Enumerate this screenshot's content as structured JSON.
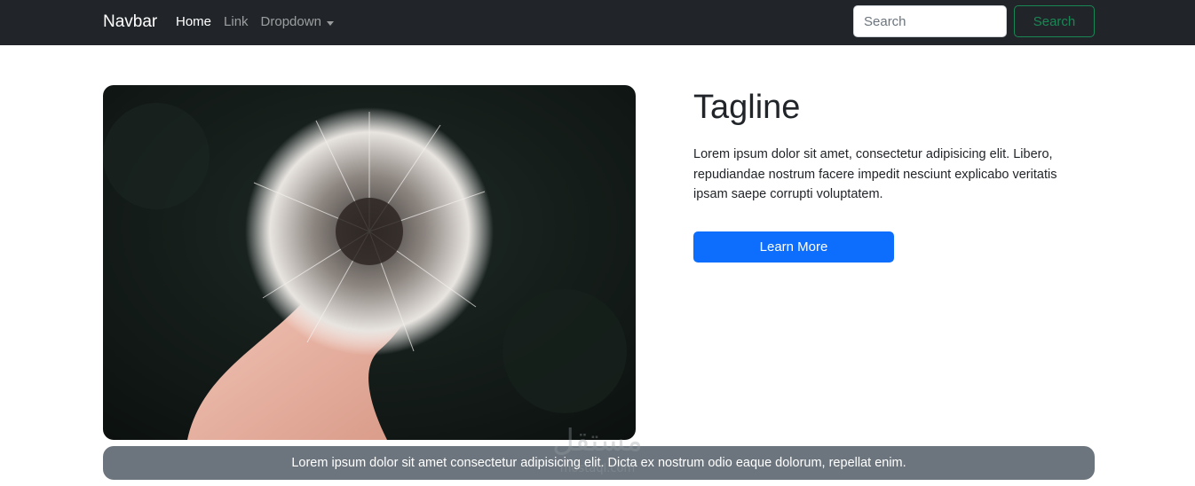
{
  "navbar": {
    "brand": "Navbar",
    "links": [
      {
        "label": "Home",
        "active": true
      },
      {
        "label": "Link",
        "active": false
      },
      {
        "label": "Dropdown",
        "active": false,
        "dropdown": true
      }
    ],
    "search": {
      "placeholder": "Search",
      "value": "",
      "button_label": "Search"
    }
  },
  "hero": {
    "image_icon": "dandelion-photo",
    "tagline": "Tagline",
    "text": "Lorem ipsum dolor sit amet, consectetur adipisicing elit. Libero, repudiandae nostrum facere impedit nesciunt explicabo veritatis ipsam saepe corrupti voluptatem.",
    "button_label": "Learn More"
  },
  "footer": {
    "text": "Lorem ipsum dolor sit amet consectetur adipisicing elit. Dicta ex nostrum odio eaque dolorum, repellat enim."
  },
  "watermark": {
    "text": "مستقل",
    "subtext": "mostaql.com"
  },
  "colors": {
    "navbar_bg": "#212529",
    "primary": "#0d6efd",
    "success": "#198754",
    "footer_bg": "#6c757d"
  }
}
